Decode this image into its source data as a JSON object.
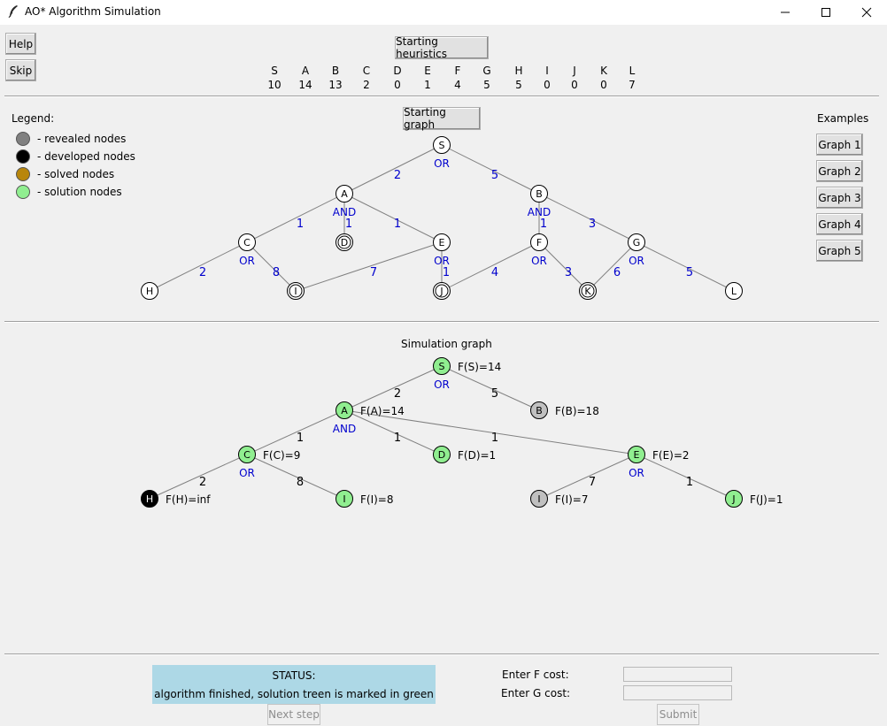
{
  "window": {
    "title": "AO* Algorithm Simulation"
  },
  "toolbar": {
    "help": "Help",
    "skip": "Skip",
    "starting_heuristics": "Starting heuristics"
  },
  "heuristics": [
    {
      "node": "S",
      "value": "10"
    },
    {
      "node": "A",
      "value": "14"
    },
    {
      "node": "B",
      "value": "13"
    },
    {
      "node": "C",
      "value": "2"
    },
    {
      "node": "D",
      "value": "0"
    },
    {
      "node": "E",
      "value": "1"
    },
    {
      "node": "F",
      "value": "4"
    },
    {
      "node": "G",
      "value": "5"
    },
    {
      "node": "H",
      "value": "5"
    },
    {
      "node": "I",
      "value": "0"
    },
    {
      "node": "J",
      "value": "0"
    },
    {
      "node": "K",
      "value": "0"
    },
    {
      "node": "L",
      "value": "7"
    }
  ],
  "legend": {
    "title": "Legend:",
    "items": [
      {
        "label": "- revealed nodes",
        "color": "#808080"
      },
      {
        "label": "- developed nodes",
        "color": "#000000"
      },
      {
        "label": "- solved nodes",
        "color": "#b8860b"
      },
      {
        "label": "- solution nodes",
        "color": "#90ee90"
      }
    ]
  },
  "starting_graph": {
    "button": "Starting graph",
    "nodes": [
      {
        "id": "S",
        "solved": false
      },
      {
        "id": "A",
        "solved": false
      },
      {
        "id": "B",
        "solved": false
      },
      {
        "id": "C",
        "solved": false
      },
      {
        "id": "D",
        "solved": true
      },
      {
        "id": "E",
        "solved": false
      },
      {
        "id": "F",
        "solved": false
      },
      {
        "id": "G",
        "solved": false
      },
      {
        "id": "H",
        "solved": false
      },
      {
        "id": "I",
        "solved": true
      },
      {
        "id": "J",
        "solved": true
      },
      {
        "id": "K",
        "solved": true
      },
      {
        "id": "L",
        "solved": false
      }
    ],
    "edges": [
      {
        "from": "S",
        "to": "A",
        "cost": "2"
      },
      {
        "from": "S",
        "to": "B",
        "cost": "5"
      },
      {
        "from": "A",
        "to": "C",
        "cost": "1"
      },
      {
        "from": "A",
        "to": "D",
        "cost": "1"
      },
      {
        "from": "A",
        "to": "E",
        "cost": "1"
      },
      {
        "from": "B",
        "to": "F",
        "cost": "1"
      },
      {
        "from": "B",
        "to": "G",
        "cost": "3"
      },
      {
        "from": "C",
        "to": "H",
        "cost": "2"
      },
      {
        "from": "C",
        "to": "I",
        "cost": "8"
      },
      {
        "from": "E",
        "to": "I",
        "cost": "7"
      },
      {
        "from": "E",
        "to": "J",
        "cost": "1"
      },
      {
        "from": "F",
        "to": "J",
        "cost": "4"
      },
      {
        "from": "F",
        "to": "K",
        "cost": "3"
      },
      {
        "from": "G",
        "to": "K",
        "cost": "6"
      },
      {
        "from": "G",
        "to": "L",
        "cost": "5"
      }
    ],
    "node_types": [
      {
        "node": "S",
        "type": "OR"
      },
      {
        "node": "A",
        "type": "AND"
      },
      {
        "node": "B",
        "type": "AND"
      },
      {
        "node": "C",
        "type": "OR"
      },
      {
        "node": "E",
        "type": "OR"
      },
      {
        "node": "F",
        "type": "OR"
      },
      {
        "node": "G",
        "type": "OR"
      }
    ]
  },
  "examples": {
    "title": "Examples",
    "buttons": [
      "Graph 1",
      "Graph 2",
      "Graph 3",
      "Graph 4",
      "Graph 5"
    ]
  },
  "simulation_graph": {
    "title": "Simulation graph",
    "nodes": [
      {
        "id": "S",
        "f": "F(S)=14",
        "state": "solution"
      },
      {
        "id": "A",
        "f": "F(A)=14",
        "state": "solution"
      },
      {
        "id": "B",
        "f": "F(B)=18",
        "state": "revealed"
      },
      {
        "id": "C",
        "f": "F(C)=9",
        "state": "solution"
      },
      {
        "id": "D",
        "f": "F(D)=1",
        "state": "solution"
      },
      {
        "id": "E",
        "f": "F(E)=2",
        "state": "solution"
      },
      {
        "id": "H",
        "f": "F(H)=inf",
        "state": "developed"
      },
      {
        "id": "I",
        "f": "F(I)=8",
        "state": "solution"
      },
      {
        "id": "I",
        "f": "F(I)=7",
        "state": "revealed"
      },
      {
        "id": "J",
        "f": "F(J)=1",
        "state": "solution"
      }
    ],
    "edges": [
      {
        "cost": "2"
      },
      {
        "cost": "5"
      },
      {
        "cost": "1"
      },
      {
        "cost": "1"
      },
      {
        "cost": "1"
      },
      {
        "cost": "2"
      },
      {
        "cost": "8"
      },
      {
        "cost": "7"
      },
      {
        "cost": "1"
      }
    ],
    "node_types": [
      {
        "node": "S",
        "type": "OR"
      },
      {
        "node": "A",
        "type": "AND"
      },
      {
        "node": "C",
        "type": "OR"
      },
      {
        "node": "E",
        "type": "OR"
      }
    ]
  },
  "status": {
    "title": "STATUS:",
    "message": "algorithm finished, solution treen is marked in green"
  },
  "controls": {
    "next_step": "Next step",
    "f_cost_label": "Enter F cost:",
    "g_cost_label": "Enter G cost:",
    "submit": "Submit"
  },
  "colors": {
    "solution": "#90ee90",
    "revealed": "#c0c0c0",
    "developed": "#000000",
    "or_and_text": "#0000cd",
    "status_bg": "#add8e6"
  }
}
